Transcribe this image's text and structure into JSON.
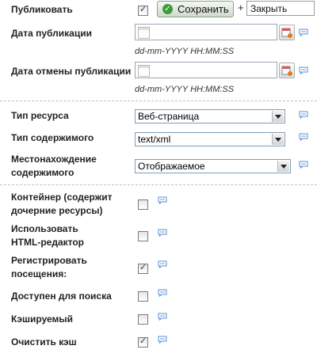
{
  "header": {
    "publish_label": "Публиковать",
    "publish_checked": true,
    "save_button": "Сохранить",
    "plus": "+",
    "close_action": "Закрыть"
  },
  "dates": {
    "pub_date_label": "Дата публикации",
    "pub_date_value": "",
    "pub_date_hint": "dd-mm-YYYY HH:MM:SS",
    "unpub_date_label": "Дата отмены публикации",
    "unpub_date_value": "",
    "unpub_date_hint": "dd-mm-YYYY HH:MM:SS"
  },
  "resource": {
    "type_label": "Тип ресурса",
    "type_value": "Веб-страница",
    "content_type_label": "Тип содержимого",
    "content_type_value": "text/xml",
    "disposition_label_line1": "Местонахождение",
    "disposition_label_line2": "содержимого",
    "disposition_value": "Отображаемое"
  },
  "options": {
    "container_line1": "Контейнер (содержит",
    "container_line2": "дочерние ресурсы)",
    "container_checked": false,
    "richtext_line1": "Использовать",
    "richtext_line2": "HTML-редактор",
    "richtext_checked": false,
    "track_line1": "Регистрировать",
    "track_line2": "посещения:",
    "track_checked": true,
    "searchable_label": "Доступен для поиска",
    "searchable_checked": false,
    "cacheable_label": "Кэшируемый",
    "cacheable_checked": false,
    "clear_cache_label": "Очистить кэш",
    "clear_cache_checked": true
  },
  "icons": {
    "help": "speech-bubble-icon",
    "calendar": "calendar-icon",
    "clear_date": "calendar-clear-icon",
    "save": "checkmark-icon",
    "dropdown": "chevron-down-icon"
  },
  "colors": {
    "checkbox_tick": "#1f3b73",
    "save_icon": "#3f9a3a",
    "help_icon": "#5b8fd6"
  }
}
